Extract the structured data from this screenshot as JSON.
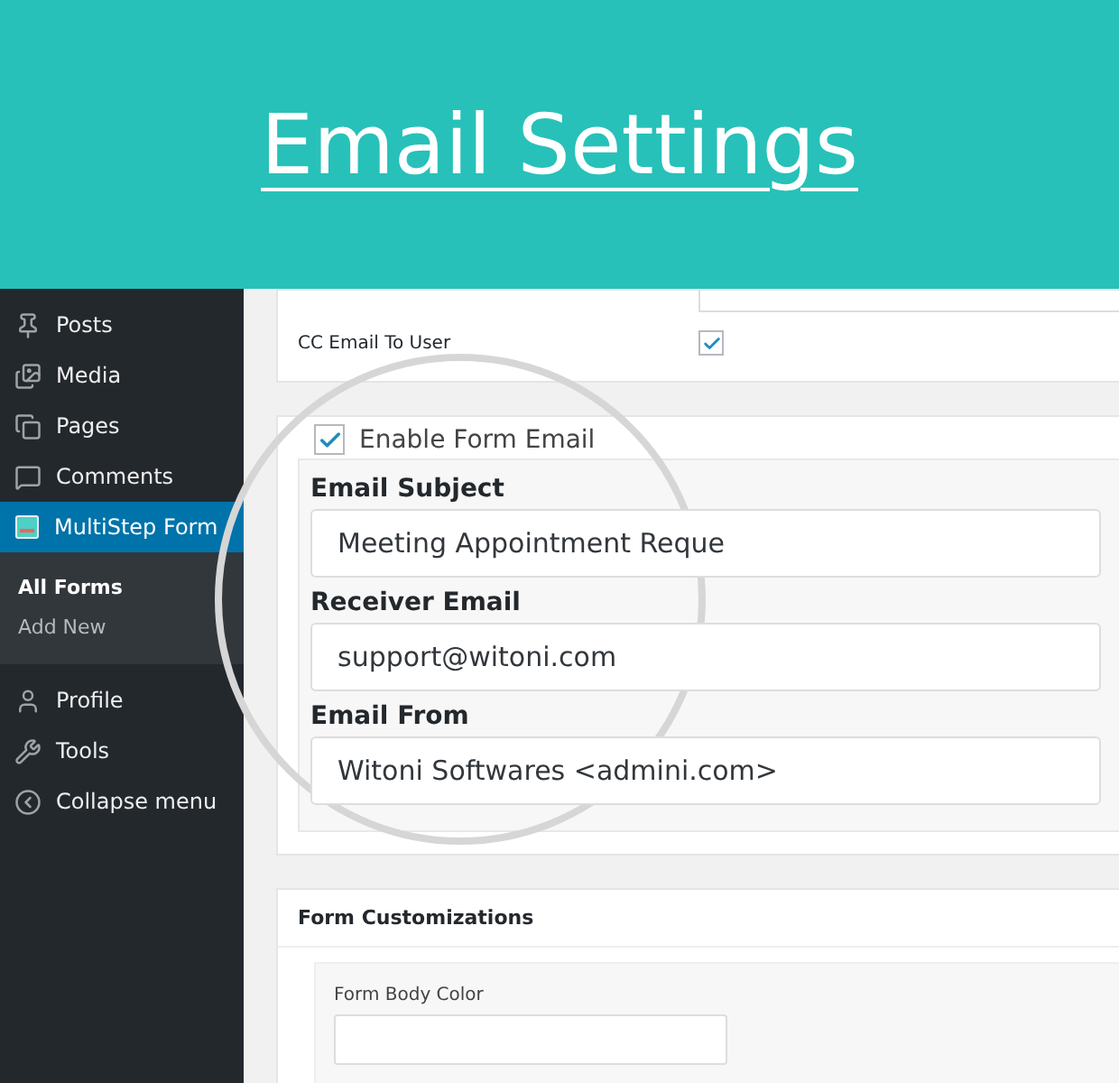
{
  "banner": {
    "title": "Email Settings"
  },
  "sidebar": {
    "items": [
      {
        "label": "Posts",
        "selected": false
      },
      {
        "label": "Media",
        "selected": false
      },
      {
        "label": "Pages",
        "selected": false
      },
      {
        "label": "Comments",
        "selected": false
      },
      {
        "label": "MultiStep Form",
        "selected": true,
        "children": [
          {
            "label": "All Forms",
            "selected": true
          },
          {
            "label": "Add New",
            "selected": false
          }
        ]
      },
      {
        "label": "Profile",
        "selected": false
      },
      {
        "label": "Tools",
        "selected": false
      },
      {
        "label": "Collapse menu",
        "selected": false
      }
    ]
  },
  "cc_row": {
    "label": "CC Email To User",
    "checked": true
  },
  "email_panel": {
    "enable": {
      "label": "Enable Form Email",
      "checked": true
    },
    "fields": [
      {
        "label": "Email Subject",
        "value": "Meeting Appointment Reque"
      },
      {
        "label": "Receiver Email",
        "value": "support@witoni.com"
      },
      {
        "label": "Email From",
        "value": "Witoni Softwares <admini.com>"
      }
    ]
  },
  "customizations": {
    "title": "Form Customizations",
    "fields": [
      {
        "label": "Form Body Color"
      }
    ]
  }
}
